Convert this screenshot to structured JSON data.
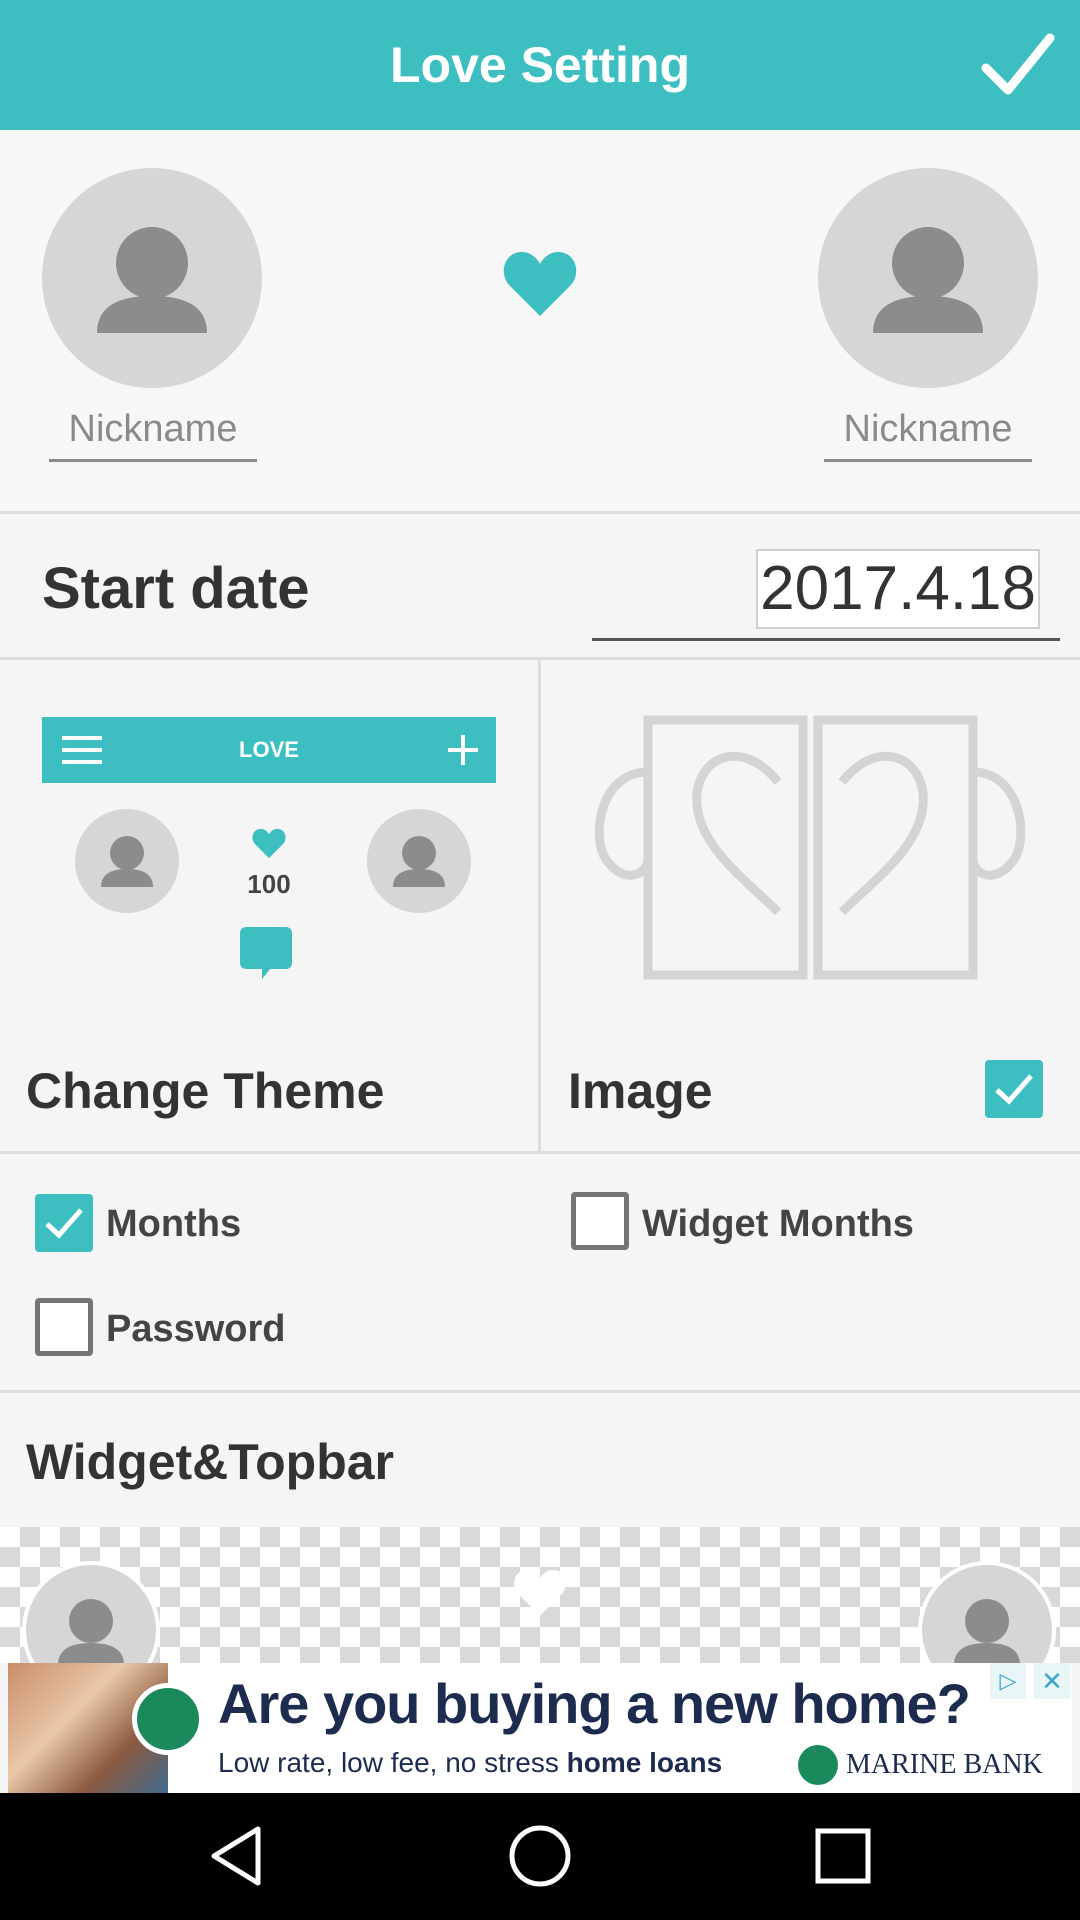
{
  "app": {
    "title": "Love Setting",
    "accent_color": "#3dbfc1",
    "confirm_icon": "check-icon"
  },
  "profiles": {
    "left": {
      "avatar_icon": "person-icon",
      "nickname_placeholder": "Nickname"
    },
    "center_icon": "heart-icon",
    "right": {
      "avatar_icon": "person-icon",
      "nickname_placeholder": "Nickname"
    }
  },
  "start_date": {
    "label": "Start date",
    "value": "2017.4.18"
  },
  "theme_preview": {
    "header_title": "LOVE",
    "counter": "100",
    "icons": [
      "menu-icon",
      "plus-icon",
      "person-icon",
      "heart-icon",
      "chat-bubble-icon"
    ]
  },
  "theme_options": {
    "change_theme_label": "Change Theme",
    "image_label": "Image",
    "image_checked": true,
    "image_placeholder_icon": "split-heart-mug-icon"
  },
  "options": {
    "months": {
      "label": "Months",
      "checked": true
    },
    "widget_months": {
      "label": "Widget Months",
      "checked": false
    },
    "password": {
      "label": "Password",
      "checked": false
    }
  },
  "widget_topbar": {
    "title": "Widget&Topbar"
  },
  "ad": {
    "headline": "Are you buying a new home?",
    "sub_prefix": "Low rate, low fee, no stress ",
    "sub_bold": "home loans",
    "bank_name": "MARINE BANK",
    "adchoices_glyph": "▷",
    "close_glyph": "✕"
  },
  "system_nav": {
    "icons": [
      "back-icon",
      "home-icon",
      "recents-icon"
    ]
  }
}
